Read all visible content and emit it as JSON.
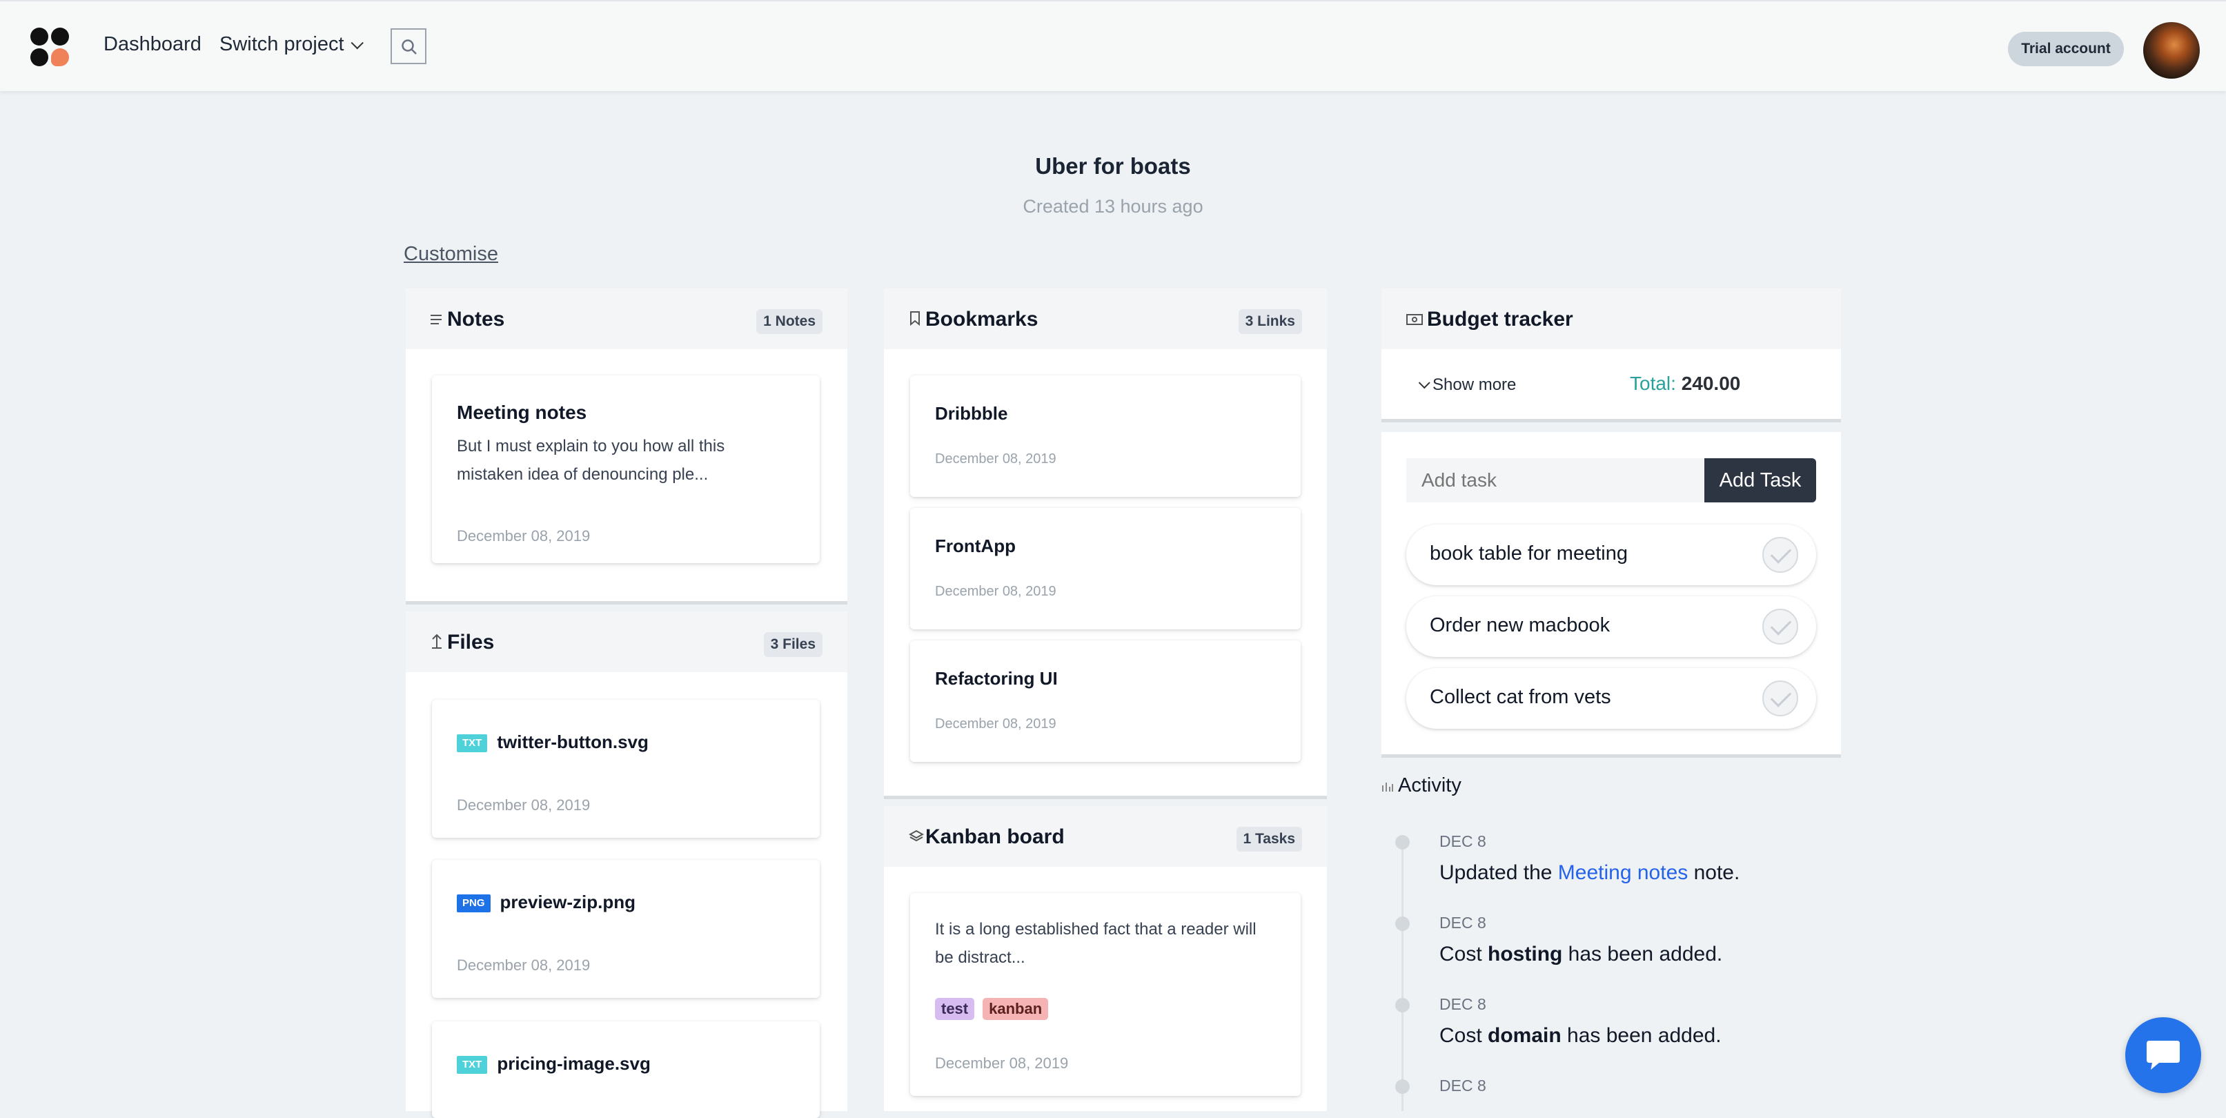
{
  "nav": {
    "dashboard": "Dashboard",
    "switch_project": "Switch project",
    "trial": "Trial account"
  },
  "project": {
    "title": "Uber for boats",
    "created": "Created 13 hours ago",
    "customise": "Customise"
  },
  "notes": {
    "title": "Notes",
    "badge": "1 Notes",
    "items": [
      {
        "title": "Meeting notes",
        "text": "But I must explain to you how all this mistaken idea of denouncing ple...",
        "date": "December 08, 2019"
      }
    ]
  },
  "files": {
    "title": "Files",
    "badge": "3 Files",
    "items": [
      {
        "type": "TXT",
        "name": "twitter-button.svg",
        "date": "December 08, 2019"
      },
      {
        "type": "PNG",
        "name": "preview-zip.png",
        "date": "December 08, 2019"
      },
      {
        "type": "TXT",
        "name": "pricing-image.svg",
        "date": ""
      }
    ]
  },
  "bookmarks": {
    "title": "Bookmarks",
    "badge": "3 Links",
    "items": [
      {
        "title": "Dribbble",
        "date": "December 08, 2019"
      },
      {
        "title": "FrontApp",
        "date": "December 08, 2019"
      },
      {
        "title": "Refactoring UI",
        "date": "December 08, 2019"
      }
    ]
  },
  "kanban": {
    "title": "Kanban board",
    "badge": "1 Tasks",
    "items": [
      {
        "text": "It is a long established fact that a reader will be distract...",
        "tags": [
          "test",
          "kanban"
        ],
        "date": "December 08, 2019"
      }
    ]
  },
  "budget": {
    "title": "Budget tracker",
    "show_more": "Show more",
    "total_label": "Total:",
    "total_value": "240.00"
  },
  "todo": {
    "placeholder": "Add task",
    "button": "Add Task",
    "items": [
      "book table for meeting",
      "Order new macbook",
      "Collect cat from vets"
    ]
  },
  "activity": {
    "title": "Activity",
    "entries": [
      {
        "date": "DEC 8",
        "pre": "Updated the ",
        "link": "Meeting notes",
        "post": " note."
      },
      {
        "date": "DEC 8",
        "pre": "Cost ",
        "bold": "hosting",
        "post": " has been added."
      },
      {
        "date": "DEC 8",
        "pre": "Cost ",
        "bold": "domain",
        "post": " has been added."
      },
      {
        "date": "DEC 8",
        "pre": "",
        "bold": "",
        "post": ""
      }
    ]
  },
  "colors": {
    "accent": "#2aa19a",
    "link": "#2563eb",
    "dark_button": "#2d3442",
    "tag_txt": "#4fd1d9",
    "tag_png": "#1d72e8",
    "tag_test": "#d6bcf0",
    "tag_kanban": "#f6b3b3",
    "chat": "#2573ea"
  }
}
